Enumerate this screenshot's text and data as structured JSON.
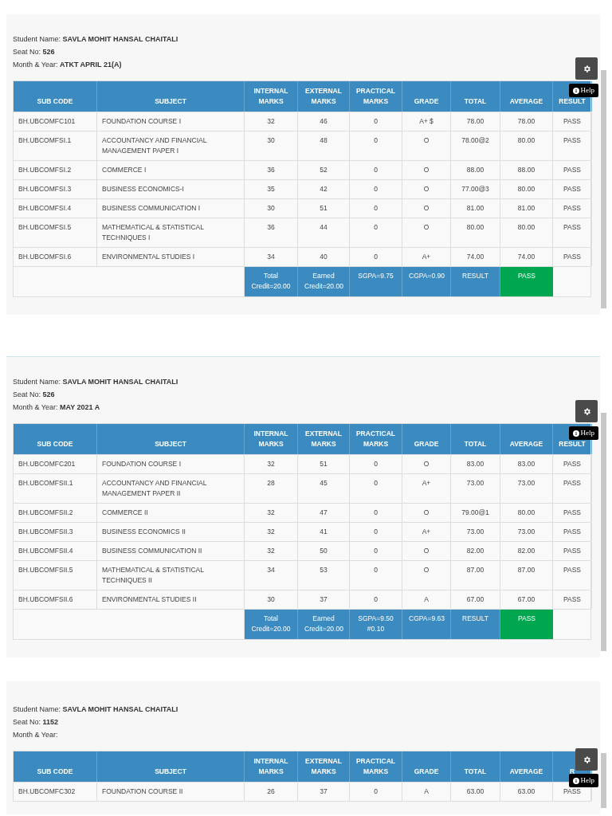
{
  "panels": [
    {
      "name_label": "Student Name:",
      "student_name": "SAVLA MOHIT HANSAL CHAITALI",
      "seat_label": "Seat No:",
      "seat_no": "526",
      "month_label": "Month & Year:",
      "month_year": "ATKT APRIL 21(A)",
      "columns": [
        "SUB CODE",
        "SUBJECT",
        "INTERNAL MARKS",
        "EXTERNAL MARKS",
        "PRACTICAL MARKS",
        "GRADE",
        "TOTAL",
        "AVERAGE",
        "RESULT"
      ],
      "rows": [
        [
          "BH.UBCOMFC101",
          "FOUNDATION COURSE I",
          "32",
          "46",
          "0",
          "A+ $",
          "78.00",
          "78.00",
          "PASS"
        ],
        [
          "BH.UBCOMFSI.1",
          "ACCOUNTANCY AND FINANCIAL MANAGEMENT PAPER I",
          "30",
          "48",
          "0",
          "O",
          "78.00@2",
          "80.00",
          "PASS"
        ],
        [
          "BH.UBCOMFSI.2",
          "COMMERCE I",
          "36",
          "52",
          "0",
          "O",
          "88.00",
          "88.00",
          "PASS"
        ],
        [
          "BH.UBCOMFSI.3",
          "BUSINESS ECONOMICS-I",
          "35",
          "42",
          "0",
          "O",
          "77.00@3",
          "80.00",
          "PASS"
        ],
        [
          "BH.UBCOMFSI.4",
          "BUSINESS COMMUNICATION I",
          "30",
          "51",
          "0",
          "O",
          "81.00",
          "81.00",
          "PASS"
        ],
        [
          "BH.UBCOMFSI.5",
          "MATHEMATICAL & STATISTICAL TECHNIQUES I",
          "36",
          "44",
          "0",
          "O",
          "80.00",
          "80.00",
          "PASS"
        ],
        [
          "BH.UBCOMFSI.6",
          "ENVIRONMENTAL STUDIES I",
          "34",
          "40",
          "0",
          "A+",
          "74.00",
          "74.00",
          "PASS"
        ]
      ],
      "summary": {
        "cells": [
          "Total Credit=20.00",
          "Earned Credit=20.00",
          "SGPA=9.75",
          "CGPA=0.90",
          "RESULT"
        ],
        "result": "PASS",
        "passed": true
      },
      "help": "Help"
    },
    {
      "name_label": "Student Name:",
      "student_name": "SAVLA MOHIT HANSAL CHAITALI",
      "seat_label": "Seat No:",
      "seat_no": "526",
      "month_label": "Month & Year:",
      "month_year": "MAY 2021 A",
      "columns": [
        "SUB CODE",
        "SUBJECT",
        "INTERNAL MARKS",
        "EXTERNAL MARKS",
        "PRACTICAL MARKS",
        "GRADE",
        "TOTAL",
        "AVERAGE",
        "RESULT"
      ],
      "rows": [
        [
          "BH.UBCOMFC201",
          "FOUNDATION COURSE I",
          "32",
          "51",
          "0",
          "O",
          "83.00",
          "83.00",
          "PASS"
        ],
        [
          "BH.UBCOMFSII.1",
          "ACCOUNTANCY AND FINANCIAL MANAGEMENT PAPER II",
          "28",
          "45",
          "0",
          "A+",
          "73.00",
          "73.00",
          "PASS"
        ],
        [
          "BH.UBCOMFSII.2",
          "COMMERCE II",
          "32",
          "47",
          "0",
          "O",
          "79.00@1",
          "80.00",
          "PASS"
        ],
        [
          "BH.UBCOMFSII.3",
          "BUSINESS ECONOMICS II",
          "32",
          "41",
          "0",
          "A+",
          "73.00",
          "73.00",
          "PASS"
        ],
        [
          "BH.UBCOMFSII.4",
          "BUSINESS COMMUNICATION II",
          "32",
          "50",
          "0",
          "O",
          "82.00",
          "82.00",
          "PASS"
        ],
        [
          "BH.UBCOMFSII.5",
          "MATHEMATICAL & STATISTICAL TECHNIQUES II",
          "34",
          "53",
          "0",
          "O",
          "87.00",
          "87.00",
          "PASS"
        ],
        [
          "BH.UBCOMFSII.6",
          "ENVIRONMENTAL STUDIES II",
          "30",
          "37",
          "0",
          "A",
          "67.00",
          "67.00",
          "PASS"
        ]
      ],
      "summary": {
        "cells": [
          "Total Credit=20.00",
          "Earned Credit=20.00",
          "SGPA=9.50 #0.10",
          "CGPA=9.63",
          "RESULT"
        ],
        "result": "PASS",
        "passed": true
      },
      "help": "Help"
    },
    {
      "name_label": "Student Name:",
      "student_name": "SAVLA MOHIT HANSAL CHAITALI",
      "seat_label": "Seat No:",
      "seat_no": "1152",
      "month_label": "Month & Year:",
      "columns": [
        "SUB CODE",
        "SUBJECT",
        "INTERNAL MARKS",
        "EXTERNAL MARKS",
        "PRACTICAL MARKS",
        "GRADE",
        "TOTAL",
        "AVERAGE",
        "R"
      ],
      "rows": [
        [
          "BH.UBCOMFC302",
          "FOUNDATION COURSE II",
          "26",
          "37",
          "0",
          "A",
          "63.00",
          "63.00",
          "PASS"
        ]
      ],
      "help": "Help"
    }
  ]
}
